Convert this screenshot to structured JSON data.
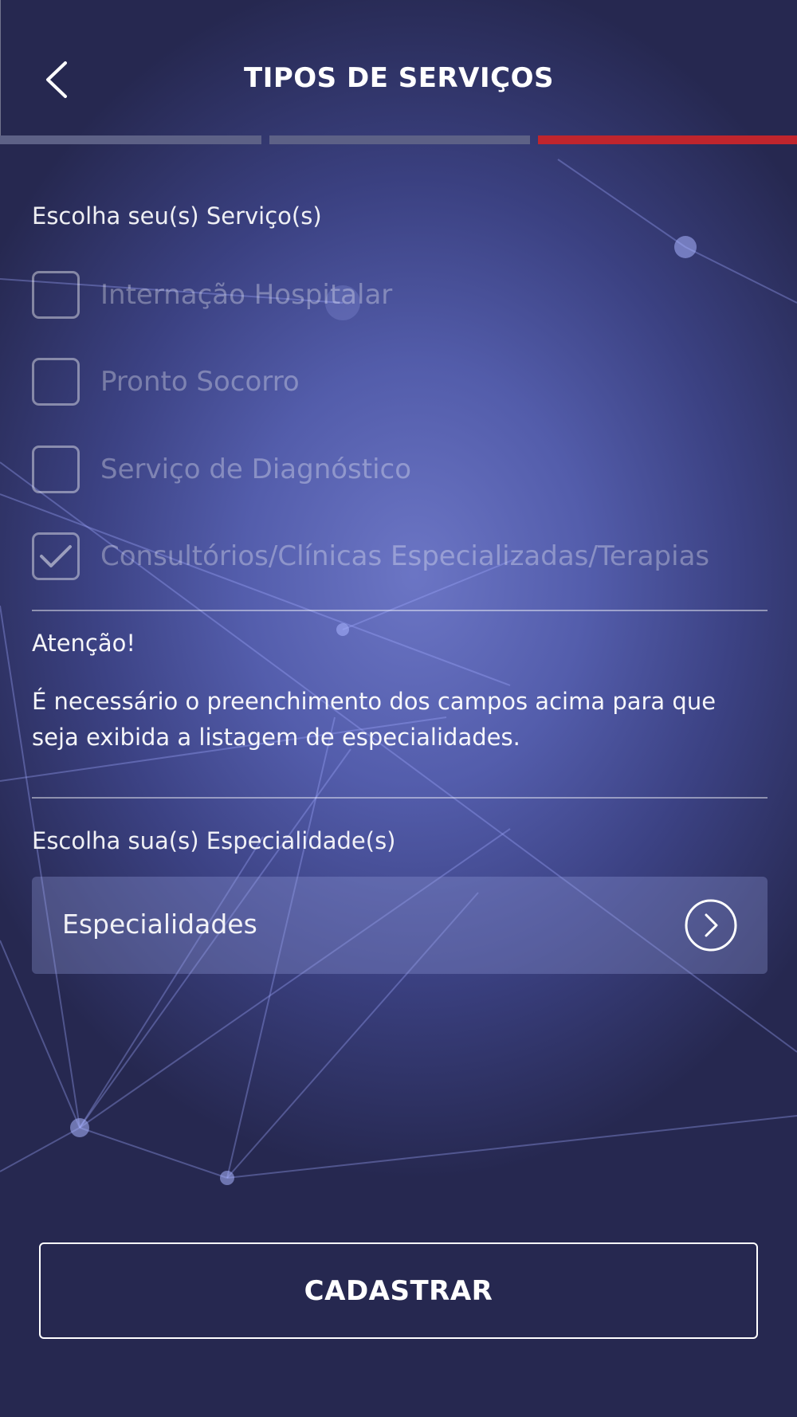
{
  "header": {
    "title": "TIPOS DE SERVIÇOS",
    "back_icon": "chevron-left-icon",
    "progress": {
      "total_steps": 3,
      "current_step": 3
    }
  },
  "services": {
    "label": "Escolha seu(s) Serviço(s)",
    "options": [
      {
        "label": "Internação Hospitalar",
        "checked": false
      },
      {
        "label": "Pronto Socorro",
        "checked": false
      },
      {
        "label": "Serviço de Diagnóstico",
        "checked": false
      },
      {
        "label": "Consultórios/Clínicas Especializadas/Terapias",
        "checked": true
      }
    ]
  },
  "notice": {
    "title": "Atenção!",
    "body": "É necessário o preenchimento dos campos acima para que seja exibida a listagem de especialidades."
  },
  "specialties": {
    "label": "Escolha sua(s) Especialidade(s)",
    "placeholder": "Especialidades",
    "arrow_icon": "chevron-right-circle-icon"
  },
  "actions": {
    "submit_label": "CADASTRAR"
  },
  "colors": {
    "accent": "#c0252d",
    "progress_inactive": "#5d6186",
    "background_dark": "#262a52",
    "background_mid": "#5a63b0"
  }
}
